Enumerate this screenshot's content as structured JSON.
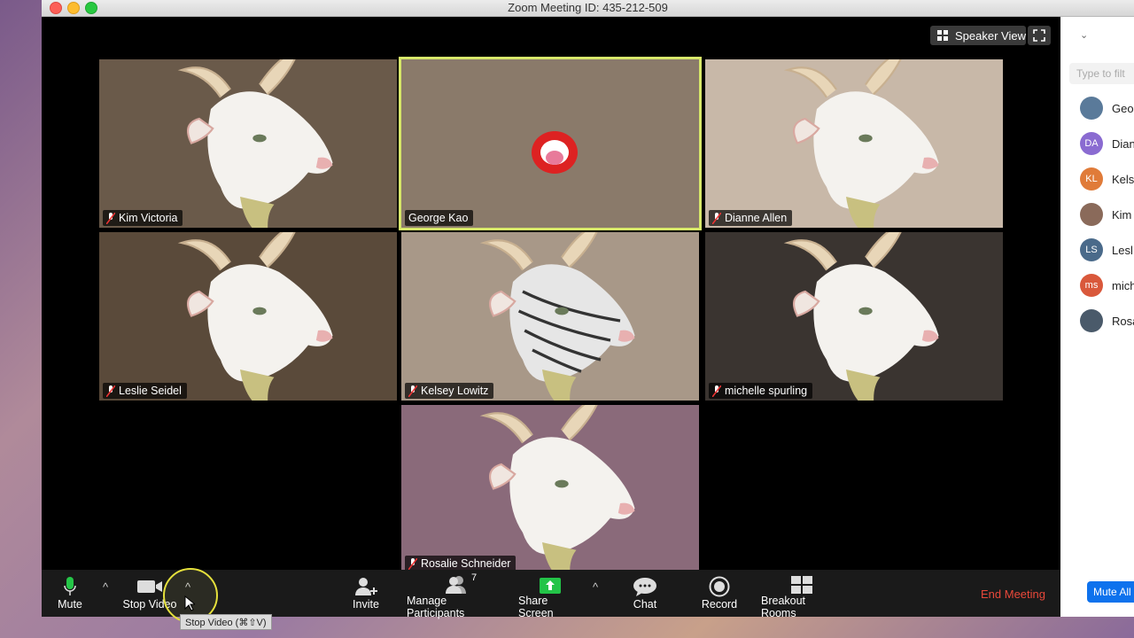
{
  "window": {
    "title": "Zoom Meeting ID: 435-212-509"
  },
  "header": {
    "view_label": "Speaker View",
    "view_icon": "grid-icon",
    "fullscreen_icon": "fullscreen-icon"
  },
  "tiles": [
    {
      "name": "Kim Victoria",
      "bg": "#6a5a4a",
      "muted": true,
      "active": false
    },
    {
      "name": "George Kao",
      "bg": "#8a7a6a",
      "muted": false,
      "active": true
    },
    {
      "name": "Dianne Allen",
      "bg": "#c8b8a8",
      "muted": true,
      "active": false
    },
    {
      "name": "Leslie Seidel",
      "bg": "#5a4a3a",
      "muted": true,
      "active": false
    },
    {
      "name": "Kelsey Lowitz",
      "bg": "#a89888",
      "muted": true,
      "active": false
    },
    {
      "name": "michelle spurling",
      "bg": "#3a3430",
      "muted": true,
      "active": false
    },
    {
      "name": "Rosalie Schneider",
      "bg": "#8a6a7a",
      "muted": true,
      "active": false
    }
  ],
  "toolbar": {
    "mute": "Mute",
    "stop_video": "Stop Video",
    "invite": "Invite",
    "manage_participants": "Manage Participants",
    "participant_count": "7",
    "share_screen": "Share Screen",
    "chat": "Chat",
    "record": "Record",
    "breakout_rooms": "Breakout Rooms",
    "end_meeting": "End Meeting",
    "tooltip": "Stop Video (⌘⇧V)"
  },
  "panel": {
    "filter_placeholder": "Type to filt",
    "participants": [
      {
        "initials": "",
        "name": "Geo",
        "color": "#5a7a9a",
        "photo": true
      },
      {
        "initials": "DA",
        "name": "Dian",
        "color": "#8a6bd1",
        "photo": false
      },
      {
        "initials": "KL",
        "name": "Kels",
        "color": "#e07b39",
        "photo": false
      },
      {
        "initials": "",
        "name": "Kim",
        "color": "#8a6a5a",
        "photo": true
      },
      {
        "initials": "LS",
        "name": "Lesl",
        "color": "#4a6a8a",
        "photo": false
      },
      {
        "initials": "ms",
        "name": "mich",
        "color": "#d9583b",
        "photo": false
      },
      {
        "initials": "",
        "name": "Rosa",
        "color": "#4a5a6a",
        "photo": true
      }
    ],
    "mute_all": "Mute All"
  },
  "colors": {
    "accent": "#0e72ed",
    "active_border": "#d8e86a",
    "end_meeting": "#e8483a",
    "share_green": "#23c448"
  }
}
